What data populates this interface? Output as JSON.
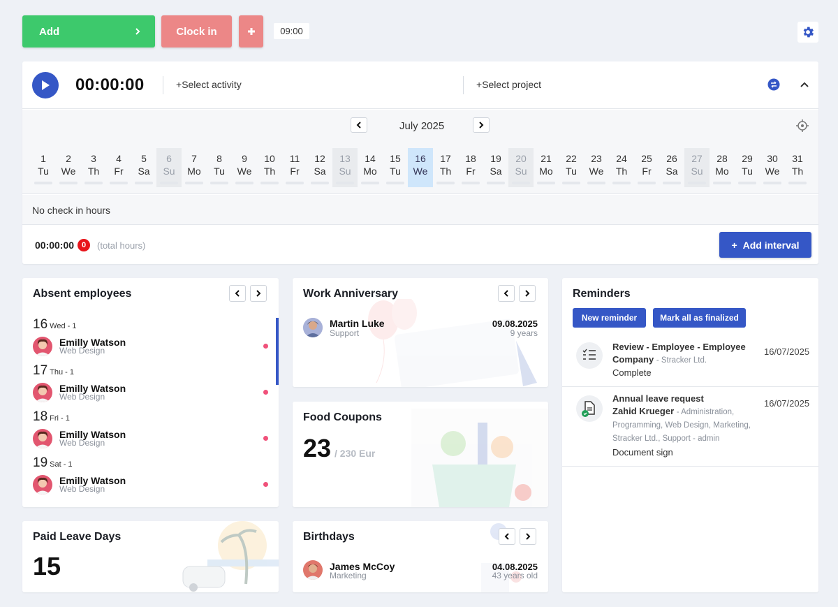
{
  "toolbar": {
    "add_label": "Add",
    "clock_in_label": "Clock in",
    "time_chip": "09:00"
  },
  "timer": {
    "value": "00:00:00",
    "select_activity": "Select activity",
    "select_project": "Select project"
  },
  "calendar": {
    "month": "July 2025",
    "days": [
      {
        "n": "1",
        "w": "Tu"
      },
      {
        "n": "2",
        "w": "We"
      },
      {
        "n": "3",
        "w": "Th"
      },
      {
        "n": "4",
        "w": "Fr"
      },
      {
        "n": "5",
        "w": "Sa"
      },
      {
        "n": "6",
        "w": "Su"
      },
      {
        "n": "7",
        "w": "Mo"
      },
      {
        "n": "8",
        "w": "Tu"
      },
      {
        "n": "9",
        "w": "We"
      },
      {
        "n": "10",
        "w": "Th"
      },
      {
        "n": "11",
        "w": "Fr"
      },
      {
        "n": "12",
        "w": "Sa"
      },
      {
        "n": "13",
        "w": "Su"
      },
      {
        "n": "14",
        "w": "Mo"
      },
      {
        "n": "15",
        "w": "Tu"
      },
      {
        "n": "16",
        "w": "We"
      },
      {
        "n": "17",
        "w": "Th"
      },
      {
        "n": "18",
        "w": "Fr"
      },
      {
        "n": "19",
        "w": "Sa"
      },
      {
        "n": "20",
        "w": "Su"
      },
      {
        "n": "21",
        "w": "Mo"
      },
      {
        "n": "22",
        "w": "Tu"
      },
      {
        "n": "23",
        "w": "We"
      },
      {
        "n": "24",
        "w": "Th"
      },
      {
        "n": "25",
        "w": "Fr"
      },
      {
        "n": "26",
        "w": "Sa"
      },
      {
        "n": "27",
        "w": "Su"
      },
      {
        "n": "28",
        "w": "Mo"
      },
      {
        "n": "29",
        "w": "Tu"
      },
      {
        "n": "30",
        "w": "We"
      },
      {
        "n": "31",
        "w": "Th"
      }
    ],
    "selected_day": "16",
    "no_check_in": "No check in hours",
    "total_time": "00:00:00",
    "total_count": "0",
    "total_label": "(total hours)",
    "add_interval": "Add interval"
  },
  "absent": {
    "title": "Absent employees",
    "entries": [
      {
        "day": "16",
        "meta": "Wed - 1",
        "name": "Emilly Watson",
        "dept": "Web Design"
      },
      {
        "day": "17",
        "meta": "Thu - 1",
        "name": "Emilly Watson",
        "dept": "Web Design"
      },
      {
        "day": "18",
        "meta": "Fri - 1",
        "name": "Emilly Watson",
        "dept": "Web Design"
      },
      {
        "day": "19",
        "meta": "Sat - 1",
        "name": "Emilly Watson",
        "dept": "Web Design"
      }
    ]
  },
  "anniversary": {
    "title": "Work Anniversary",
    "name": "Martin Luke",
    "dept": "Support",
    "date": "09.08.2025",
    "years": "9 years"
  },
  "food": {
    "title": "Food Coupons",
    "count": "23",
    "total": "/ 230 Eur"
  },
  "leave": {
    "title": "Paid Leave Days",
    "count": "15"
  },
  "birthdays": {
    "title": "Birthdays",
    "name": "James McCoy",
    "dept": "Marketing",
    "date": "04.08.2025",
    "age": "43 years old"
  },
  "reminders": {
    "title": "Reminders",
    "new_label": "New reminder",
    "mark_label": "Mark all as finalized",
    "items": [
      {
        "line1": "Review - Employee - Employee",
        "line2": "Company",
        "sub": "- Stracker Ltd.",
        "status": "Complete",
        "date": "16/07/2025"
      },
      {
        "line1": "Annual leave request",
        "line2": "Zahid Krueger",
        "sub": "- Administration,",
        "sub2": "Programming, Web Design, Marketing,",
        "sub3": "Stracker Ltd., Support - admin",
        "status": "Document sign",
        "date": "16/07/2025"
      }
    ]
  },
  "colors": {
    "add_green": "#3dc96c",
    "clock_red": "#ec8787",
    "primary_blue": "#3557c6",
    "today_blue": "#cfe6fb",
    "dot_pink": "#f0517a",
    "badge_red": "#e8141a"
  }
}
